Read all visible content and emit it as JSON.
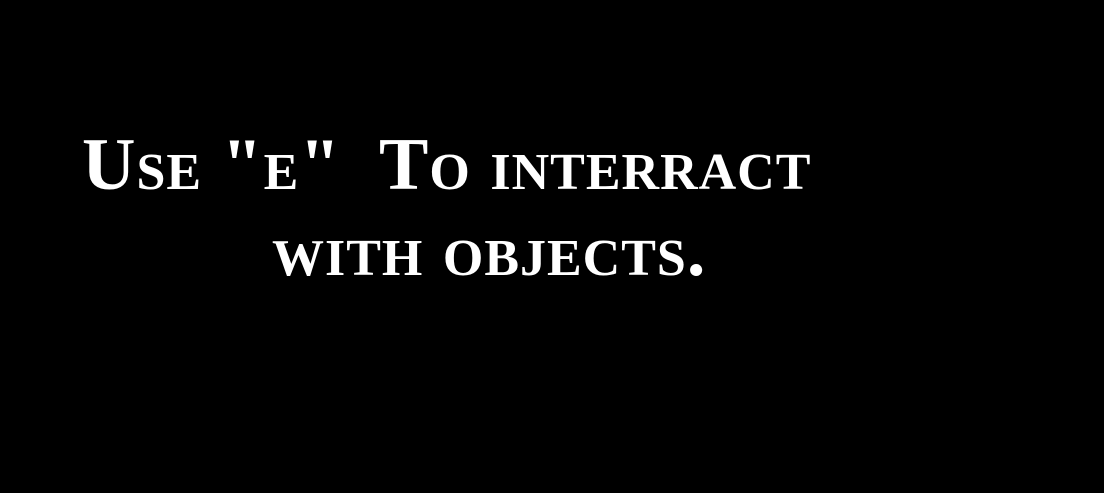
{
  "screen": {
    "background_color": "#000000",
    "text_color": "#ffffff",
    "message": {
      "line1": "Use \"e\"  To interract",
      "line2": "with objects."
    }
  }
}
